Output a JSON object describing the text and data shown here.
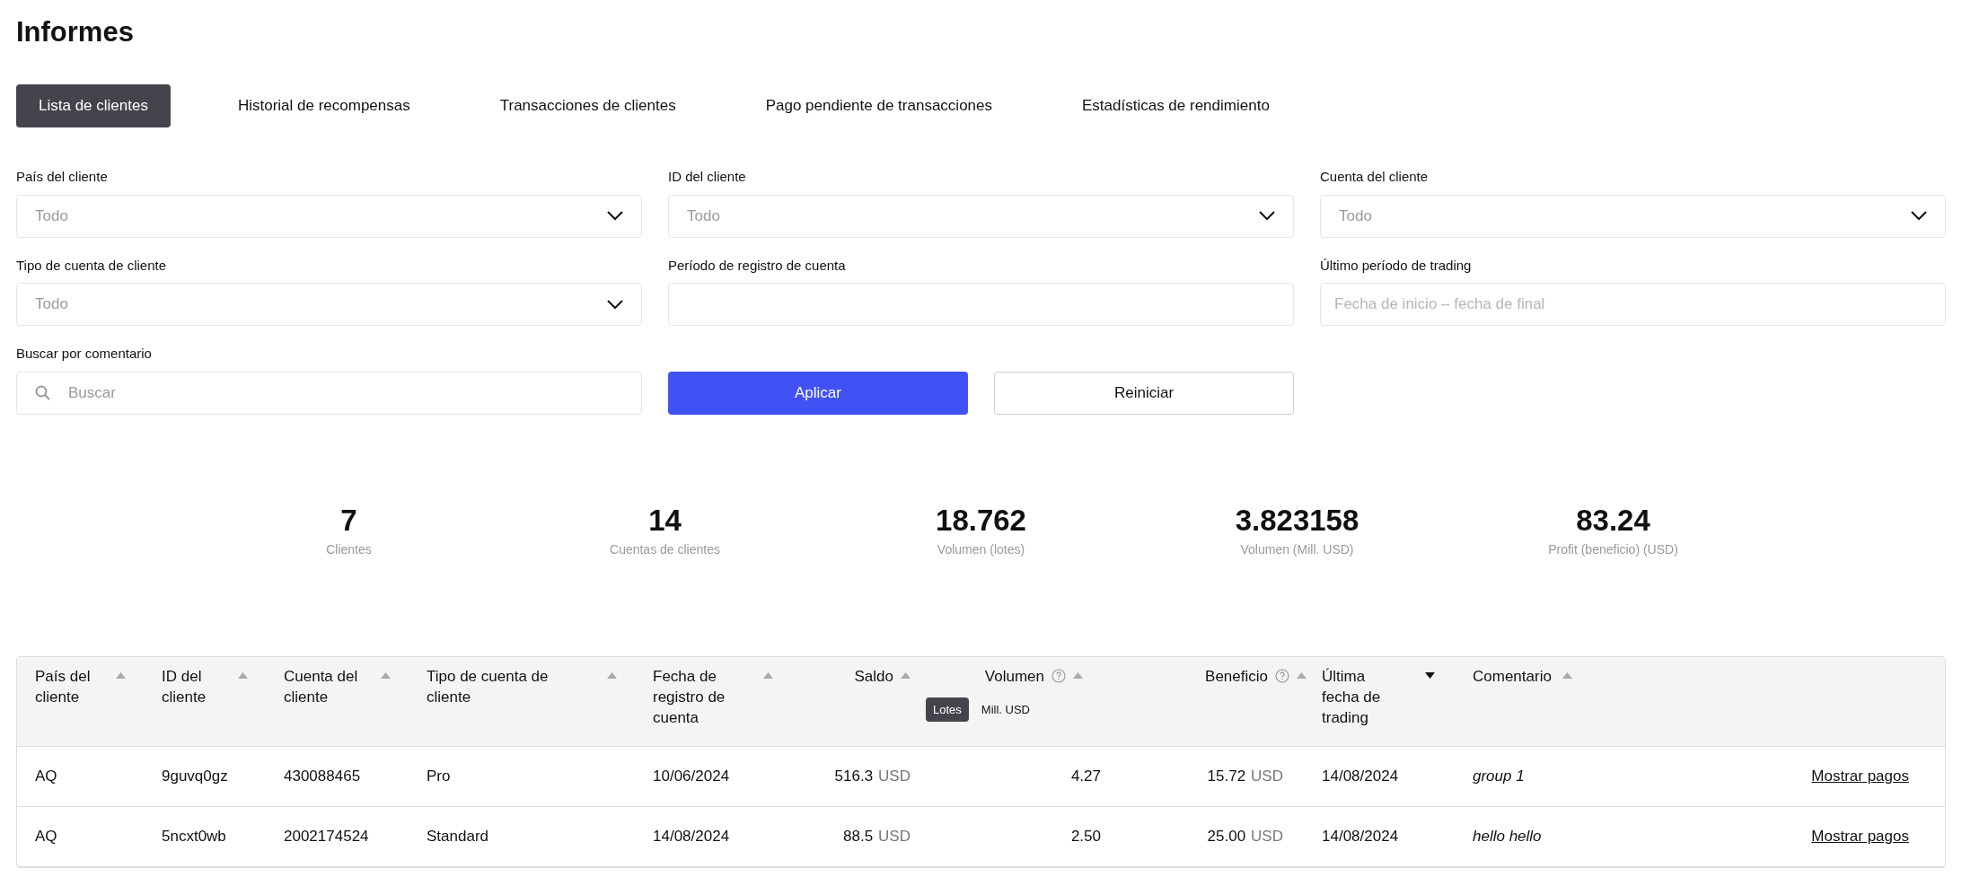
{
  "title": "Informes",
  "tabs": [
    {
      "label": "Lista de clientes",
      "selected": true
    },
    {
      "label": "Historial de recompensas",
      "selected": false
    },
    {
      "label": "Transacciones de clientes",
      "selected": false
    },
    {
      "label": "Pago pendiente de transacciones",
      "selected": false
    },
    {
      "label": "Estadísticas de rendimiento",
      "selected": false
    }
  ],
  "filters": [
    {
      "kind": "select",
      "label": "País del cliente",
      "value": "Todo"
    },
    {
      "kind": "select",
      "label": "ID del cliente",
      "value": "Todo"
    },
    {
      "kind": "select",
      "label": "Cuenta del cliente",
      "value": "Todo"
    },
    {
      "kind": "select",
      "label": "Tipo de cuenta de cliente",
      "value": "Todo"
    },
    {
      "kind": "input",
      "label": "Período de registro de cuenta"
    },
    {
      "kind": "input",
      "label": "Último período de trading",
      "placeholder": "Fecha de inicio – fecha de final"
    },
    {
      "kind": "search",
      "label": "Buscar por comentario",
      "placeholder": "Buscar"
    }
  ],
  "buttons": {
    "apply": "Aplicar",
    "reset": "Reiniciar"
  },
  "stats": [
    {
      "value": "7",
      "label": "Clientes"
    },
    {
      "value": "14",
      "label": "Cuentas de clientes"
    },
    {
      "value": "18.762",
      "label": "Volumen (lotes)"
    },
    {
      "value": "3.823158",
      "label": "Volumen (Mill. USD)"
    },
    {
      "value": "83.24",
      "label": "Profit (beneficio) (USD)"
    }
  ],
  "table": {
    "columns": [
      {
        "label": "País del cliente",
        "sort_active": false
      },
      {
        "label": "ID del cliente",
        "sort_active": false
      },
      {
        "label": "Cuenta del cliente",
        "sort_active": false
      },
      {
        "label": "Tipo de cuenta de cliente",
        "sort_active": false
      },
      {
        "label": "Fecha de registro de cuenta",
        "sort_active": false
      },
      {
        "label": "Saldo",
        "sort_active": false
      },
      {
        "label": "Volumen",
        "sort_active": false,
        "help": true,
        "units": [
          {
            "label": "Lotes",
            "selected": true
          },
          {
            "label": "Mill. USD",
            "selected": false
          }
        ]
      },
      {
        "label": "Beneficio",
        "sort_active": false,
        "help": true
      },
      {
        "label": "Última fecha de trading",
        "sort_active": true
      },
      {
        "label": "Comentario",
        "sort_active": false
      }
    ],
    "rows": [
      {
        "country": "AQ",
        "id": "9guvq0gz",
        "account": "430088465",
        "type": "Pro",
        "registered": "10/06/2024",
        "balance": "516.3",
        "balance_currency": "USD",
        "volume": "4.27",
        "profit": "15.72",
        "profit_currency": "USD",
        "last_trade": "14/08/2024",
        "comment": "group 1",
        "action": "Mostrar pagos"
      },
      {
        "country": "AQ",
        "id": "5ncxt0wb",
        "account": "2002174524",
        "type": "Standard",
        "registered": "14/08/2024",
        "balance": "88.5",
        "balance_currency": "USD",
        "volume": "2.50",
        "profit": "25.00",
        "profit_currency": "USD",
        "last_trade": "14/08/2024",
        "comment": "hello hello",
        "action": "Mostrar pagos"
      }
    ]
  }
}
